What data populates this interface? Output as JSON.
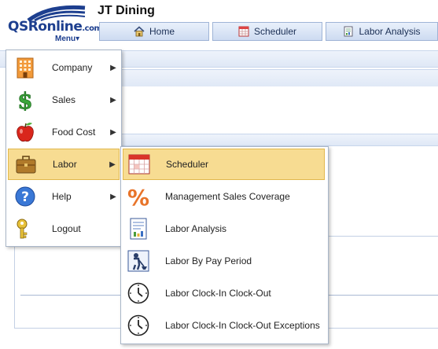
{
  "header": {
    "logo_text": "QSRonline",
    "logo_suffix": ".com",
    "logo_menu": "Menu▾",
    "title": "JT Dining"
  },
  "nav": [
    {
      "label": "Home",
      "icon": "home-icon"
    },
    {
      "label": "Scheduler",
      "icon": "calendar-icon"
    },
    {
      "label": "Labor Analysis",
      "icon": "report-icon"
    }
  ],
  "main_menu": {
    "items": [
      {
        "label": "Company",
        "icon": "building-icon",
        "has_submenu": true
      },
      {
        "label": "Sales",
        "icon": "dollar-icon",
        "has_submenu": true
      },
      {
        "label": "Food Cost",
        "icon": "apple-icon",
        "has_submenu": true
      },
      {
        "label": "Labor",
        "icon": "briefcase-icon",
        "has_submenu": true,
        "active": true
      },
      {
        "label": "Help",
        "icon": "help-icon",
        "has_submenu": true
      },
      {
        "label": "Logout",
        "icon": "key-icon",
        "has_submenu": false
      }
    ],
    "arrow": "▶"
  },
  "labor_submenu": {
    "items": [
      {
        "label": "Scheduler",
        "icon": "calendar-icon",
        "active": true
      },
      {
        "label": "Management Sales Coverage",
        "icon": "percent-icon"
      },
      {
        "label": "Labor Analysis",
        "icon": "report-icon"
      },
      {
        "label": "Labor By Pay Period",
        "icon": "worker-icon"
      },
      {
        "label": "Labor Clock-In Clock-Out",
        "icon": "clock-icon"
      },
      {
        "label": "Labor Clock-In Clock-Out Exceptions",
        "icon": "clock-icon"
      }
    ]
  },
  "colors": {
    "accent": "#1d3f8f",
    "highlight": "#f7dc92",
    "highlight_border": "#e2b84d",
    "nav_bg": "#d8e4f5"
  }
}
